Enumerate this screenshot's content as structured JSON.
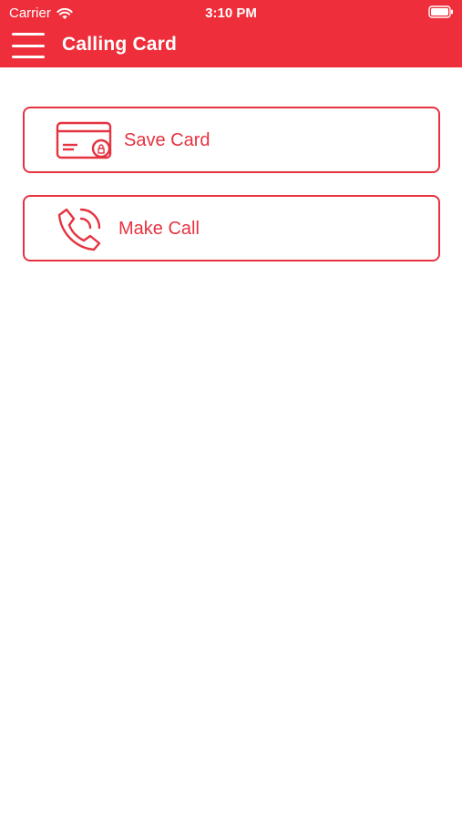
{
  "status_bar": {
    "carrier": "Carrier",
    "time": "3:10 PM"
  },
  "nav": {
    "title": "Calling Card",
    "menu_icon": "hamburger-menu-icon"
  },
  "actions": [
    {
      "label": "Save Card",
      "icon": "credit-card-icon"
    },
    {
      "label": "Make Call",
      "icon": "phone-call-icon"
    }
  ],
  "colors": {
    "brand_red": "#ee2e3a",
    "accent_red": "#e53340",
    "background": "#ffffff"
  }
}
